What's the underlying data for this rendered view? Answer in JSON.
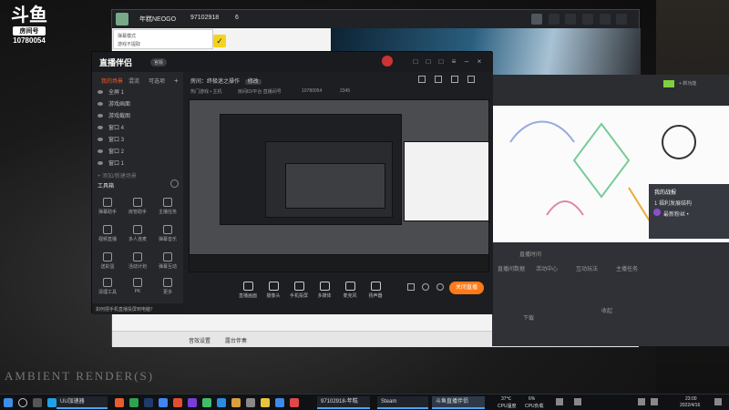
{
  "overlay": {
    "logo_glyph": "斗鱼",
    "logo_box": "房间号",
    "room_number": "10780054",
    "bottom_caption": "AMBIENT RENDER(S)"
  },
  "bg_app": {
    "user_name": "年糕NEOGO",
    "user_id": "97102918",
    "follow_count": "6",
    "hint_line1": "弹幕模式",
    "hint_line2": "游戏不提取",
    "bottom_labels": [
      "音效设置",
      "露台伴奏"
    ]
  },
  "right_dashboard": {
    "top_label": "+ 新功能",
    "stat_labels": [
      "直播时间",
      "直播间数据",
      "活动中心",
      "互动玩法",
      "主播任务",
      "收起"
    ],
    "card_title": "我的战报",
    "card_line1": "1 福利发展结构",
    "card_line2": "最新粉丝 • ",
    "footer_label": "下载"
  },
  "main": {
    "app_title": "直播伴侣",
    "version_badge": "官版",
    "tabs": [
      "我的场景",
      "混流",
      "可选项"
    ],
    "scenes": [
      "全屏 1",
      "游戏画面",
      "游戏截图",
      "窗口 4",
      "窗口 3",
      "窗口 2",
      "窗口 1"
    ],
    "add_scene": "+ 添加/新建场景",
    "tools_title": "工具箱",
    "tools": [
      "弹幕助手",
      "房管助手",
      "主播任务",
      "视频直播",
      "多人连麦",
      "弹幕音乐",
      "送彩蛋",
      "活动计划",
      "弹幕互动",
      "清理工具",
      "PK",
      "更多"
    ],
    "sidebar_tip": "如何把手机直播投屏到电脑？",
    "room_title_prefix": "房间：",
    "room_title": "终极迷之操作",
    "room_title_badge": "修改",
    "room_meta": [
      "热门游戏 • 主机",
      "房间ID/平台 直播间号",
      "10780054",
      "2345"
    ],
    "bottom_tools": [
      "直播画面",
      "摄像头",
      "手机投屏",
      "多媒体",
      "麦克风",
      "扬声器"
    ],
    "go_live": "关闭直播"
  },
  "taskbar": {
    "tasks": [
      "UU加速器",
      "97102918-年糕",
      "Steam",
      "斗鱼直播伴侣"
    ],
    "temp": "37℃",
    "temp_label": "CPU温度",
    "cpu": "6%",
    "cpu_label": "CPU负载",
    "time": "23:00",
    "date": "2022/4/16"
  }
}
